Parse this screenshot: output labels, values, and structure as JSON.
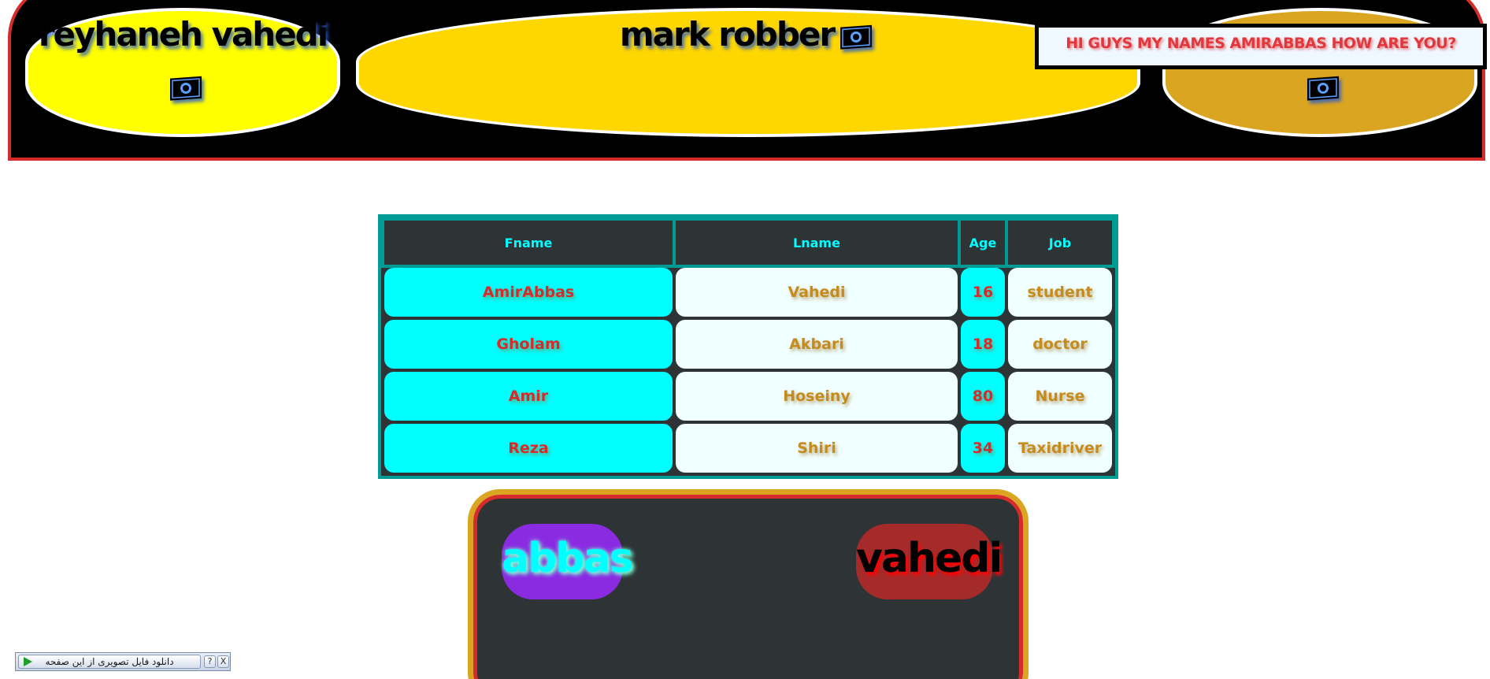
{
  "header": {
    "left_title": "reyhaneh vahedi",
    "middle_title": "mark robber",
    "greeting": "HI GUYS MY NAMES AMIRABBAS HOW ARE YOU?",
    "icon": "money-bill-icon",
    "colors": {
      "background": "#000000",
      "border": "#d62b2b",
      "left_pill": "#ffff00",
      "middle_pill": "#ffd700",
      "right_pill": "#daa520"
    }
  },
  "table": {
    "headers": [
      "Fname",
      "Lname",
      "Age",
      "Job"
    ],
    "rows": [
      {
        "fname": "AmirAbbas",
        "lname": "Vahedi",
        "age": "16",
        "job": "student"
      },
      {
        "fname": "Gholam",
        "lname": "Akbari",
        "age": "18",
        "job": "doctor"
      },
      {
        "fname": "Amir",
        "lname": "Hoseiny",
        "age": "80",
        "job": "Nurse"
      },
      {
        "fname": "Reza",
        "lname": "Shiri",
        "age": "34",
        "job": "Taxidriver"
      }
    ],
    "colors": {
      "header_bg": "#2e3436",
      "header_text": "#00ffff",
      "border": "#009b95",
      "cyan_cell": "#00ffff",
      "light_cell": "#f0ffff"
    }
  },
  "bottom_box": {
    "first_name": "abbas",
    "last_name": "vahedi",
    "colors": {
      "background": "#2e3436",
      "first_pill": "#8a2be2",
      "last_pill": "#a52a2a"
    }
  },
  "download_bar": {
    "label": "دانلود فایل تصویری از این صفحه",
    "help": "?",
    "close": "X"
  }
}
